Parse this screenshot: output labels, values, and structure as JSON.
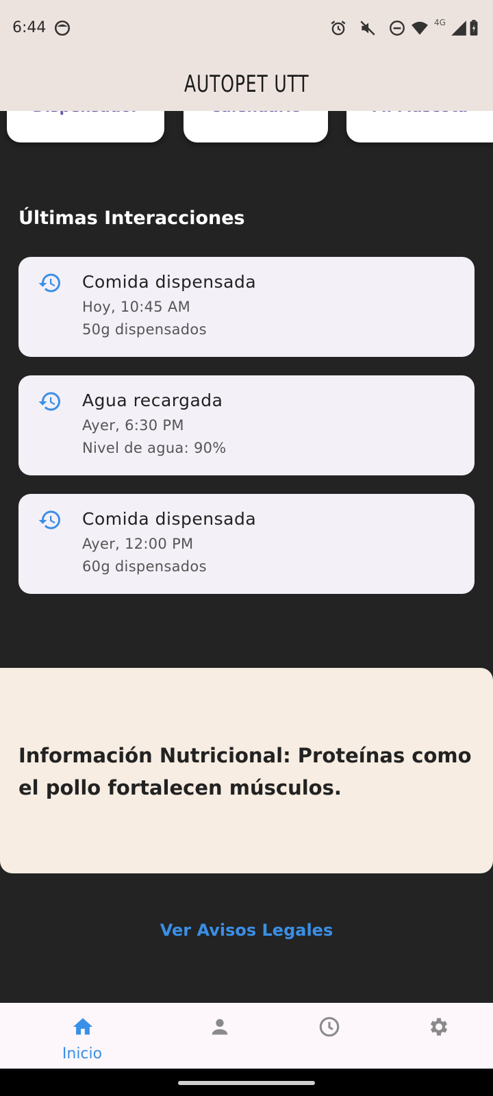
{
  "status_bar": {
    "time": "6:44",
    "icons": [
      "face-icon",
      "alarm-icon",
      "vibrate-off-icon",
      "dnd-icon",
      "wifi-icon",
      "4g-signal-icon",
      "battery-icon"
    ],
    "network_label": "4G"
  },
  "app_bar": {
    "title": "AUTOPET UTT"
  },
  "top_cards": [
    {
      "label": "Dispensador"
    },
    {
      "label": "Calendario"
    },
    {
      "label": "Mi Mascota"
    }
  ],
  "interactions": {
    "title": "Últimas Interacciones",
    "items": [
      {
        "icon": "history-icon",
        "title": "Comida dispensada",
        "line1": "Hoy, 10:45 AM",
        "line2": "50g dispensados"
      },
      {
        "icon": "history-icon",
        "title": "Agua recargada",
        "line1": "Ayer, 6:30 PM",
        "line2": "Nivel de agua: 90%"
      },
      {
        "icon": "history-icon",
        "title": "Comida dispensada",
        "line1": "Ayer, 12:00 PM",
        "line2": "60g dispensados"
      }
    ]
  },
  "info_card": {
    "text": "Información Nutricional: Proteínas como el pollo fortalecen músculos."
  },
  "legal_link": {
    "label": "Ver Avisos Legales"
  },
  "bottom_nav": {
    "items": [
      {
        "icon": "home-icon",
        "label": "Inicio",
        "active": true
      },
      {
        "icon": "person-icon",
        "label": "",
        "active": false
      },
      {
        "icon": "clock-icon",
        "label": "",
        "active": false
      },
      {
        "icon": "settings-icon",
        "label": "",
        "active": false
      }
    ]
  },
  "colors": {
    "background": "#232323",
    "app_bar": "#ede3de",
    "card": "#f4f0f7",
    "info_card": "#f7ede2",
    "accent": "#3a8fe6",
    "nav_inactive": "#8a8a8a"
  }
}
